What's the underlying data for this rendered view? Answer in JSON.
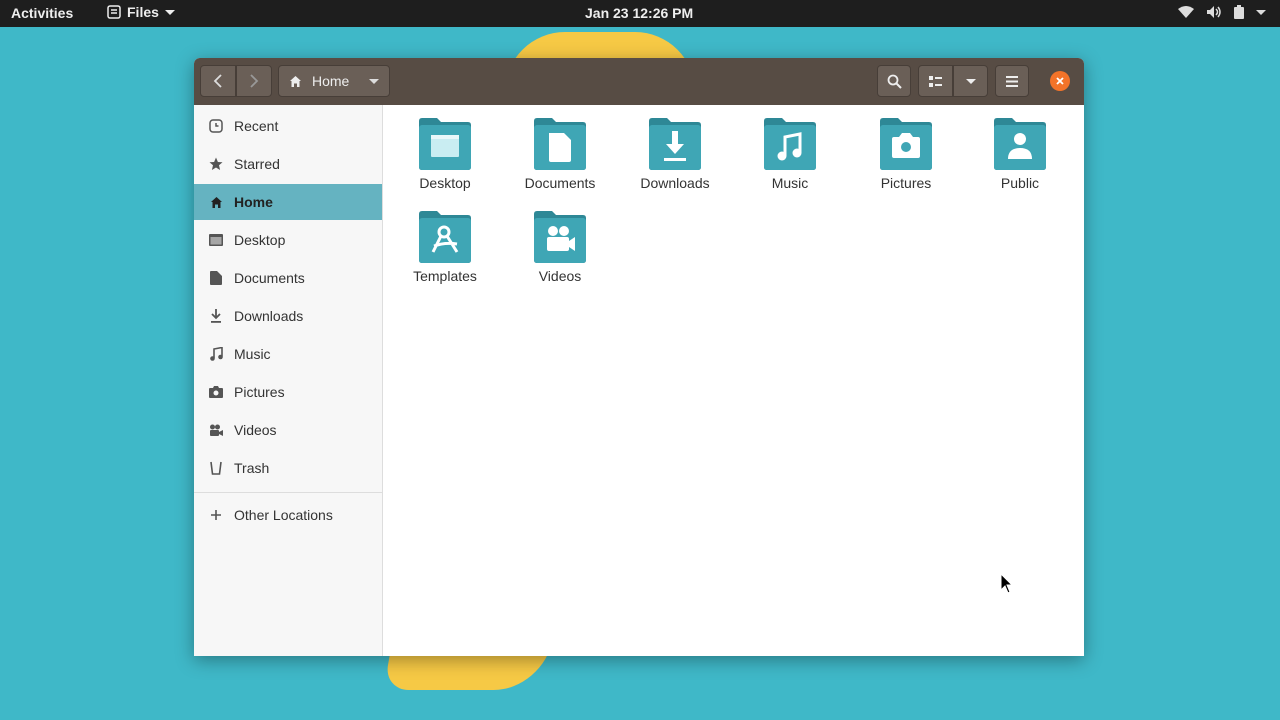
{
  "topbar": {
    "activities": "Activities",
    "app_name": "Files",
    "clock": "Jan 23  12:26 PM"
  },
  "window": {
    "path_label": "Home"
  },
  "sidebar": {
    "items": [
      {
        "label": "Recent",
        "icon": "clock-icon"
      },
      {
        "label": "Starred",
        "icon": "star-icon"
      },
      {
        "label": "Home",
        "icon": "home-icon",
        "active": true
      },
      {
        "label": "Desktop",
        "icon": "desktop-icon"
      },
      {
        "label": "Documents",
        "icon": "document-icon"
      },
      {
        "label": "Downloads",
        "icon": "download-icon"
      },
      {
        "label": "Music",
        "icon": "music-icon"
      },
      {
        "label": "Pictures",
        "icon": "camera-icon"
      },
      {
        "label": "Videos",
        "icon": "video-icon"
      },
      {
        "label": "Trash",
        "icon": "trash-icon"
      }
    ],
    "other_locations": "Other Locations"
  },
  "content": {
    "folders": [
      {
        "label": "Desktop",
        "icon": "desktop-folder-icon"
      },
      {
        "label": "Documents",
        "icon": "documents-folder-icon"
      },
      {
        "label": "Downloads",
        "icon": "downloads-folder-icon"
      },
      {
        "label": "Music",
        "icon": "music-folder-icon"
      },
      {
        "label": "Pictures",
        "icon": "pictures-folder-icon"
      },
      {
        "label": "Public",
        "icon": "public-folder-icon"
      },
      {
        "label": "Templates",
        "icon": "templates-folder-icon"
      },
      {
        "label": "Videos",
        "icon": "videos-folder-icon"
      }
    ]
  },
  "colors": {
    "desktop_bg": "#3fb8c8",
    "headerbar": "#574c44",
    "selection": "#65b3c1",
    "folder": "#3fa6b5",
    "close": "#f37329"
  }
}
